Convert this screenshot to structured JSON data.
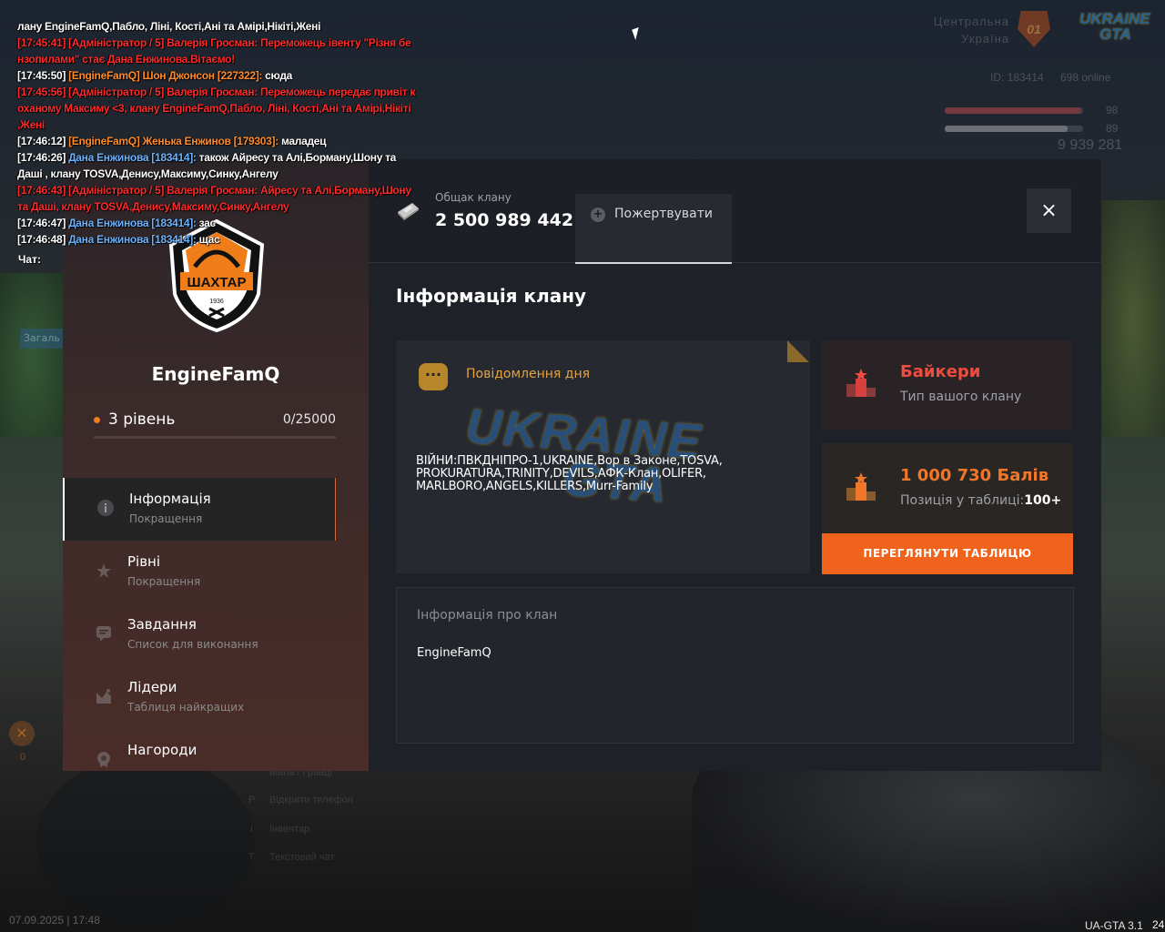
{
  "chat": {
    "lines": [
      [
        {
          "c": "white",
          "t": "лану EngineFamQ,Пабло, Ліні, Кості,Ані та Амірі,Нікіті,Жені"
        }
      ],
      [
        {
          "c": "red",
          "t": "[17:45:41] [Адміністратор / 5] Валерія Гросман: Переможець івенту \"Різня бе нзопилами\" стає Дана Енжинова.Вітаємо!"
        }
      ],
      [
        {
          "c": "white",
          "t": "[17:45:50] "
        },
        {
          "c": "orange",
          "t": "[EngineFamQ] Шон Джонсон [227322]: "
        },
        {
          "c": "white",
          "t": "сюда"
        }
      ],
      [
        {
          "c": "red",
          "t": "[17:45:56] [Адміністратор / 5] Валерія Гросман: Переможець передає привіт к оханому Максиму <3, клану EngineFamQ,Пабло, Ліні, Кості,Ані та Амірі,Нікіті ,Жені"
        }
      ],
      [
        {
          "c": "white",
          "t": "[17:46:12] "
        },
        {
          "c": "orange",
          "t": "[EngineFamQ] Женька Енжинов [179303]: "
        },
        {
          "c": "white",
          "t": "маладец"
        }
      ],
      [
        {
          "c": "white",
          "t": "[17:46:26] "
        },
        {
          "c": "blue",
          "t": "Дана Енжинова [183414]: "
        },
        {
          "c": "white",
          "t": "також Айресу та Алі,Борману,Шону та Даші , клану TOSVA,Денису,Максиму,Синку,Ангелу"
        }
      ],
      [
        {
          "c": "red",
          "t": "[17:46:43] [Адміністратор / 5] Валерія Гросман: Айресу та Алі,Борману,Шону та Даші, клану TOSVA,Денису,Максиму,Синку,Ангелу"
        }
      ],
      [
        {
          "c": "white",
          "t": "[17:46:47] "
        },
        {
          "c": "blue",
          "t": "Дана Енжинова [183414]: "
        },
        {
          "c": "white",
          "t": "зас"
        }
      ],
      [
        {
          "c": "white",
          "t": "[17:46:48] "
        },
        {
          "c": "blue",
          "t": "Дана Енжинова [183414]: "
        },
        {
          "c": "white",
          "t": "щас"
        }
      ]
    ],
    "label": "Чат:"
  },
  "hud": {
    "region_line1": "Центральна",
    "region_line2": "Україна",
    "region_number": "01",
    "logo_line1": "UKRAINE",
    "logo_line2": "GTA",
    "player_id": "ID: 183414",
    "online": "698 online",
    "health": "98",
    "health_fill": 0.98,
    "armor": "89",
    "armor_fill": 0.89,
    "money": "9 939 281"
  },
  "sidebar": {
    "emblem_text": "ШАХТАР",
    "emblem_year": "1936",
    "clan_name": "EngineFamQ",
    "level": "3 рівень",
    "xp": "0/25000",
    "xp_fill": 0,
    "nav": [
      {
        "title": "Інформація",
        "sub": "Покращення",
        "icon": "info-icon"
      },
      {
        "title": "Рівні",
        "sub": "Покращення",
        "icon": "star-icon"
      },
      {
        "title": "Завдання",
        "sub": "Список для виконання",
        "icon": "tasks-icon"
      },
      {
        "title": "Лідери",
        "sub": "Таблиця найкращих",
        "icon": "leaders-icon"
      },
      {
        "title": "Нагороди",
        "sub": "",
        "icon": "award-icon"
      }
    ]
  },
  "header": {
    "bank_label": "Общак клану",
    "bank_value": "2 500 989 442",
    "donate_label": "Пожертвувати",
    "close_label": "×"
  },
  "main": {
    "title": "Інформація клану",
    "motd_label": "Повідомлення дня",
    "motd_icon": "chat-bubble-icon",
    "motd_text": "ВІЙНИ:ПВКДНІПРО-1,UKRAINE,Вор в Законе,TOSVA,\nPROKURATURA,TRINITY,DEVILS,АФК-Клан,OLIFER,\nMARLBORO,ANGELS,KILLERS,Murr-Family",
    "motd_watermark_line1": "UKRAINE",
    "motd_watermark_line2": "GTA",
    "clan_type_title": "Байкери",
    "clan_type_sub": "Тип вашого клану",
    "points_title": "1 000 730 Балів",
    "points_sub": "Позиція у таблиці:",
    "points_pos": "100+",
    "table_button": "ПЕРЕГЛЯНУТИ ТАБЛИЦЮ",
    "about_label": "Інформація про клан",
    "about_value": "EngineFamQ"
  },
  "bottom": {
    "hint_map": "Мапа / Гравці",
    "hint_phone": "Відкрити телефон",
    "hint_inventory": "Інвентар",
    "hint_chat": "Текстовий чат",
    "key_phone": "P",
    "key_inventory": "I",
    "key_chat": "T",
    "zagal": "Загаль",
    "mini_count": "0",
    "datetime": "07.09.2025 | 17:48",
    "version": "UA-GTA 3.1",
    "fps": "24"
  },
  "colors": {
    "accent": "#f0631c",
    "chat_red": "#ff2a2a",
    "chat_orange": "#ff8a2a",
    "chat_blue": "#6bb3ff",
    "clan_type": "#f04c40",
    "motd_label": "#e6a340"
  }
}
